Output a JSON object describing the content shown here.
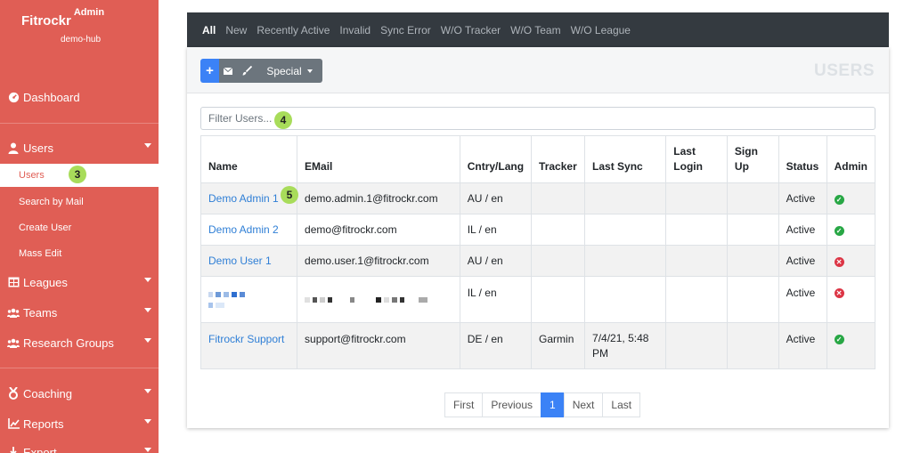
{
  "brand": {
    "name": "Fitrockr",
    "role": "Admin",
    "hub": "demo-hub"
  },
  "sidebar": {
    "items": [
      {
        "label": "Dashboard",
        "icon": "dashboard-icon"
      },
      {
        "label": "Users",
        "icon": "user-icon"
      },
      {
        "label": "Leagues",
        "icon": "table-icon"
      },
      {
        "label": "Teams",
        "icon": "users-icon"
      },
      {
        "label": "Research Groups",
        "icon": "users-icon"
      },
      {
        "label": "Coaching",
        "icon": "coach-icon"
      },
      {
        "label": "Reports",
        "icon": "chart-icon"
      },
      {
        "label": "Export",
        "icon": "export-icon"
      }
    ],
    "subitems": [
      {
        "label": "Users"
      },
      {
        "label": "Search by Mail"
      },
      {
        "label": "Create User"
      },
      {
        "label": "Mass Edit"
      }
    ]
  },
  "annotations": {
    "a3": "3",
    "a4": "4",
    "a5": "5"
  },
  "tabs": [
    "All",
    "New",
    "Recently Active",
    "Invalid",
    "Sync Error",
    "W/O Tracker",
    "W/O Team",
    "W/O League"
  ],
  "toolbar": {
    "plus": "+",
    "special_label": "Special"
  },
  "page_title": "USERS",
  "filter": {
    "placeholder": "Filter Users..."
  },
  "table": {
    "headers": [
      "Name",
      "EMail",
      "Cntry/Lang",
      "Tracker",
      "Last Sync",
      "Last Login",
      "Sign Up",
      "Status",
      "Admin"
    ],
    "rows": [
      {
        "name": "Demo Admin 1",
        "email": "demo.admin.1@fitrockr.com",
        "country": "AU / en",
        "tracker": "",
        "last_sync": "",
        "last_login": "",
        "sign_up": "",
        "status": "Active",
        "admin": true
      },
      {
        "name": "Demo Admin 2",
        "email": "demo@fitrockr.com",
        "country": "IL / en",
        "tracker": "",
        "last_sync": "",
        "last_login": "",
        "sign_up": "",
        "status": "Active",
        "admin": true
      },
      {
        "name": "Demo User 1",
        "email": "demo.user.1@fitrockr.com",
        "country": "AU / en",
        "tracker": "",
        "last_sync": "",
        "last_login": "",
        "sign_up": "",
        "status": "Active",
        "admin": false
      },
      {
        "name": "",
        "email": "",
        "country": "IL / en",
        "tracker": "",
        "last_sync": "",
        "last_login": "",
        "sign_up": "",
        "status": "Active",
        "admin": false
      },
      {
        "name": "Fitrockr Support",
        "email": "support@fitrockr.com",
        "country": "DE / en",
        "tracker": "Garmin",
        "last_sync": "7/4/21, 5:48 PM",
        "last_login": "",
        "sign_up": "",
        "status": "Active",
        "admin": true
      }
    ]
  },
  "pagination": [
    "First",
    "Previous",
    "1",
    "Next",
    "Last"
  ],
  "colors": {
    "sidebar": "#e05e55",
    "accent": "#3b82f6",
    "ok": "#28a745",
    "no": "#dc3545",
    "badge": "#a8dc5a"
  }
}
